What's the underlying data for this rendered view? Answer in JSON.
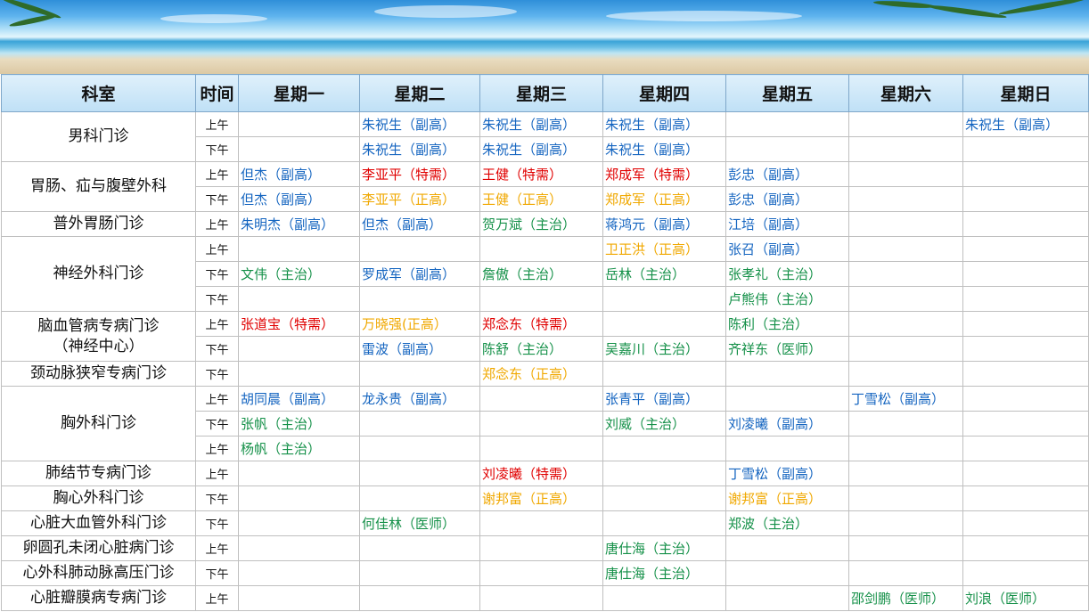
{
  "header": {
    "dept": "科室",
    "time": "时间",
    "days": [
      "星期一",
      "星期二",
      "星期三",
      "星期四",
      "星期五",
      "星期六",
      "星期日"
    ]
  },
  "colors": {
    "blue": "#1565c0",
    "red": "#e00000",
    "orange": "#f0a800",
    "green": "#149048"
  },
  "groups": [
    {
      "dept": "男科门诊",
      "rows": [
        {
          "time": "上午",
          "cells": [
            null,
            {
              "t": "朱祝生（副高）",
              "c": "blue"
            },
            {
              "t": "朱祝生（副高）",
              "c": "blue"
            },
            {
              "t": "朱祝生（副高）",
              "c": "blue"
            },
            null,
            null,
            {
              "t": "朱祝生（副高）",
              "c": "blue"
            }
          ]
        },
        {
          "time": "下午",
          "cells": [
            null,
            {
              "t": "朱祝生（副高）",
              "c": "blue"
            },
            {
              "t": "朱祝生（副高）",
              "c": "blue"
            },
            {
              "t": "朱祝生（副高）",
              "c": "blue"
            },
            null,
            null,
            null
          ]
        }
      ]
    },
    {
      "dept": "胃肠、疝与腹壁外科",
      "rows": [
        {
          "time": "上午",
          "cells": [
            {
              "t": "但杰（副高）",
              "c": "blue"
            },
            {
              "t": "李亚平（特需）",
              "c": "red"
            },
            {
              "t": "王健（特需）",
              "c": "red"
            },
            {
              "t": "郑成军（特需）",
              "c": "red"
            },
            {
              "t": "彭忠（副高）",
              "c": "blue"
            },
            null,
            null
          ]
        },
        {
          "time": "下午",
          "cells": [
            {
              "t": "但杰（副高）",
              "c": "blue"
            },
            {
              "t": "李亚平（正高）",
              "c": "orange"
            },
            {
              "t": "王健（正高）",
              "c": "orange"
            },
            {
              "t": "郑成军（正高）",
              "c": "orange"
            },
            {
              "t": "彭忠（副高）",
              "c": "blue"
            },
            null,
            null
          ]
        }
      ]
    },
    {
      "dept": "普外胃肠门诊",
      "rows": [
        {
          "time": "上午",
          "cells": [
            {
              "t": "朱明杰（副高）",
              "c": "blue"
            },
            {
              "t": "但杰（副高）",
              "c": "blue"
            },
            {
              "t": " 贺万斌（主治）",
              "c": "green"
            },
            {
              "t": " 蒋鸿元（副高）",
              "c": "blue"
            },
            {
              "t": "江培（副高）",
              "c": "blue"
            },
            null,
            null
          ]
        }
      ]
    },
    {
      "dept": "神经外科门诊",
      "rows": [
        {
          "time": "上午",
          "cells": [
            null,
            null,
            null,
            {
              "t": "卫正洪（正高）",
              "c": "orange"
            },
            {
              "t": "张召（副高）",
              "c": "blue"
            },
            null,
            null
          ]
        },
        {
          "time": "下午",
          "cells": [
            {
              "t": "文伟（主治）",
              "c": "green"
            },
            {
              "t": "罗成军（副高）",
              "c": "blue"
            },
            {
              "t": "詹傲（主治）",
              "c": "green"
            },
            {
              "t": "岳林（主治）",
              "c": "green"
            },
            {
              "t": "张孝礼（主治）",
              "c": "green"
            },
            null,
            null
          ]
        },
        {
          "time": "下午",
          "cells": [
            null,
            null,
            null,
            null,
            {
              "t": "卢熊伟（主治）",
              "c": "green"
            },
            null,
            null
          ]
        }
      ]
    },
    {
      "dept": "脑血管病专病门诊\n（神经中心）",
      "rows": [
        {
          "time": "上午",
          "cells": [
            {
              "t": "张道宝（特需）",
              "c": "red"
            },
            {
              "t": "万晓强(正高）",
              "c": "orange"
            },
            {
              "t": "郑念东（特需）",
              "c": "red"
            },
            null,
            {
              "t": "陈利（主治）",
              "c": "green"
            },
            null,
            null
          ]
        },
        {
          "time": "下午",
          "cells": [
            null,
            {
              "t": "雷波（副高）",
              "c": "blue"
            },
            {
              "t": "陈舒（主治）",
              "c": "green"
            },
            {
              "t": "吴嘉川（主治）",
              "c": "green"
            },
            {
              "t": "齐祥东（医师）",
              "c": "green"
            },
            null,
            null
          ]
        }
      ]
    },
    {
      "dept": "颈动脉狭窄专病门诊",
      "rows": [
        {
          "time": "下午",
          "cells": [
            null,
            null,
            {
              "t": "郑念东（正高）",
              "c": "orange"
            },
            null,
            null,
            null,
            null
          ]
        }
      ]
    },
    {
      "dept": "胸外科门诊",
      "rows": [
        {
          "time": "上午",
          "cells": [
            {
              "t": "胡同晨（副高）",
              "c": "blue"
            },
            {
              "t": "龙永贵（副高）",
              "c": "blue"
            },
            null,
            {
              "t": "张青平（副高）",
              "c": "blue"
            },
            null,
            {
              "t": "丁雪松（副高）",
              "c": "blue"
            },
            null
          ]
        },
        {
          "time": "下午",
          "cells": [
            {
              "t": "张帆（主治）",
              "c": "green"
            },
            null,
            null,
            {
              "t": "刘威（主治）",
              "c": "green"
            },
            {
              "t": "刘凌曦（副高）",
              "c": "blue"
            },
            null,
            null
          ]
        },
        {
          "time": "上午",
          "cells": [
            {
              "t": "杨帆（主治）",
              "c": "green"
            },
            null,
            null,
            null,
            null,
            null,
            null
          ]
        }
      ]
    },
    {
      "dept": "肺结节专病门诊",
      "rows": [
        {
          "time": "上午",
          "cells": [
            null,
            null,
            {
              "t": "刘凌曦（特需）",
              "c": "red"
            },
            null,
            {
              "t": "丁雪松（副高）",
              "c": "blue"
            },
            null,
            null
          ]
        }
      ]
    },
    {
      "dept": "胸心外科门诊",
      "rows": [
        {
          "time": "下午",
          "cells": [
            null,
            null,
            {
              "t": "谢邦富（正高）",
              "c": "orange"
            },
            null,
            {
              "t": "谢邦富（正高）",
              "c": "orange"
            },
            null,
            null
          ]
        }
      ]
    },
    {
      "dept": "心脏大血管外科门诊",
      "rows": [
        {
          "time": "下午",
          "cells": [
            null,
            {
              "t": "何佳林（医师）",
              "c": "green"
            },
            null,
            null,
            {
              "t": "郑波（主治）",
              "c": "green"
            },
            null,
            null
          ]
        }
      ]
    },
    {
      "dept": "卵圆孔未闭心脏病门诊",
      "rows": [
        {
          "time": "上午",
          "cells": [
            null,
            null,
            null,
            {
              "t": "唐仕海（主治）",
              "c": "green"
            },
            null,
            null,
            null
          ]
        }
      ]
    },
    {
      "dept": "心外科肺动脉高压门诊",
      "rows": [
        {
          "time": "下午",
          "cells": [
            null,
            null,
            null,
            {
              "t": "唐仕海（主治）",
              "c": "green"
            },
            null,
            null,
            null
          ]
        }
      ]
    },
    {
      "dept": "心脏瓣膜病专病门诊",
      "rows": [
        {
          "time": "上午",
          "cells": [
            null,
            null,
            null,
            null,
            null,
            {
              "t": "邵剑鹏（医师）",
              "c": "green"
            },
            {
              "t": "刘浪（医师）",
              "c": "green"
            }
          ]
        }
      ]
    }
  ]
}
